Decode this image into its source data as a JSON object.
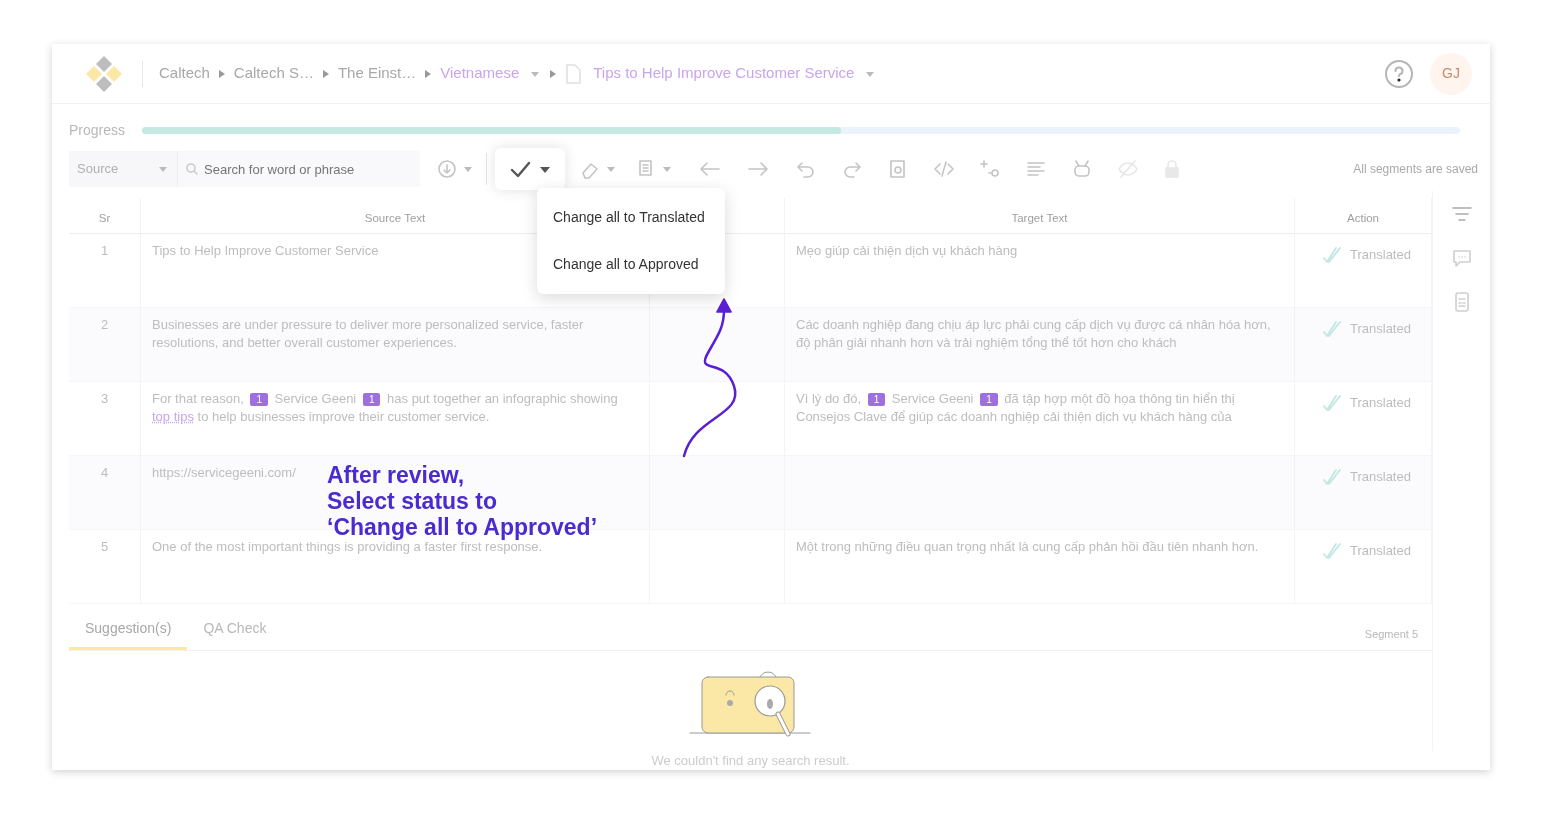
{
  "breadcrumb": [
    {
      "text": "Caltech",
      "accent": false,
      "dropdown": false,
      "doc": false
    },
    {
      "text": "Caltech S…",
      "accent": false,
      "dropdown": false,
      "doc": false
    },
    {
      "text": "The Einst…",
      "accent": false,
      "dropdown": false,
      "doc": false
    },
    {
      "text": "Vietnamese",
      "accent": true,
      "dropdown": true,
      "doc": false
    },
    {
      "text": "Tips to Help Improve Customer Service",
      "accent": true,
      "dropdown": true,
      "doc": true
    }
  ],
  "avatar": "GJ",
  "progress": {
    "label": "Progress",
    "level": 0.53
  },
  "toolbar": {
    "source_select": "Source",
    "search_placeholder": "Search for word or phrase",
    "status_menu": {
      "open": true,
      "items": [
        "Change all to Translated",
        "Change all to Approved"
      ]
    },
    "saved_text": "All segments are saved"
  },
  "table": {
    "columns": [
      "Sr",
      "Source Text",
      "Target Text",
      "Action"
    ],
    "rows": [
      {
        "sr": "1",
        "source": [
          {
            "kind": "text",
            "text": "Tips to Help Improve Customer Service"
          }
        ],
        "target": [
          {
            "kind": "text",
            "text": "Mẹo giúp cải thiện dịch vụ khách hàng"
          }
        ],
        "status": "Translated"
      },
      {
        "sr": "2",
        "source": [
          {
            "kind": "text",
            "text": "Businesses are under pressure to deliver more personalized service, faster resolutions, and better overall customer experiences."
          }
        ],
        "target": [
          {
            "kind": "text",
            "text": "Các doanh nghiệp đang chịu áp lực phải cung cấp dịch vụ được cá nhân hóa hơn, độ phân giải nhanh hơn và trải nghiệm tổng thể tốt hơn cho khách"
          }
        ],
        "status": "Translated"
      },
      {
        "sr": "3",
        "source": [
          {
            "kind": "text",
            "text": "For that reason,"
          },
          {
            "kind": "tag",
            "text": "1"
          },
          {
            "kind": "text",
            "text": "Service Geeni"
          },
          {
            "kind": "tag",
            "text": "1"
          },
          {
            "kind": "text",
            "text": "has put together an infographic showing"
          },
          {
            "kind": "link",
            "text": "top tips"
          },
          {
            "kind": "text",
            "text": "to help businesses improve their customer service."
          }
        ],
        "target": [
          {
            "kind": "text",
            "text": "Vì lý do đó,"
          },
          {
            "kind": "tag",
            "text": "1"
          },
          {
            "kind": "text",
            "text": "Service Geeni"
          },
          {
            "kind": "tag",
            "text": "1"
          },
          {
            "kind": "text",
            "text": "đã tập hợp một đồ họa thông tin hiển thị Consejos Clave để giúp các doanh nghiệp cải thiện dịch vụ khách hàng của"
          }
        ],
        "status": "Translated"
      },
      {
        "sr": "4",
        "source": [
          {
            "kind": "text",
            "text": "https://servicegeeni.com/"
          }
        ],
        "target": [],
        "status": "Translated"
      },
      {
        "sr": "5",
        "source": [
          {
            "kind": "text",
            "text": "One of the most important things is providing a faster first response."
          }
        ],
        "target": [
          {
            "kind": "text",
            "text": "Một trong những điều quan trọng nhất là cung cấp phản hồi đầu tiên nhanh hơn."
          }
        ],
        "status": "Translated"
      }
    ]
  },
  "side_tools": [
    {
      "selected": true
    },
    {
      "selected": false
    },
    {
      "selected": false
    }
  ],
  "bottom_tabs": [
    {
      "label": "Suggestion(s)",
      "selected": true
    },
    {
      "label": "QA Check",
      "selected": false
    }
  ],
  "segment_label": "Segment 5",
  "empty_message": "We couldn't find any search result.",
  "annotation": [
    "After review,",
    "Select status to",
    "‘Change all to Approved’"
  ]
}
